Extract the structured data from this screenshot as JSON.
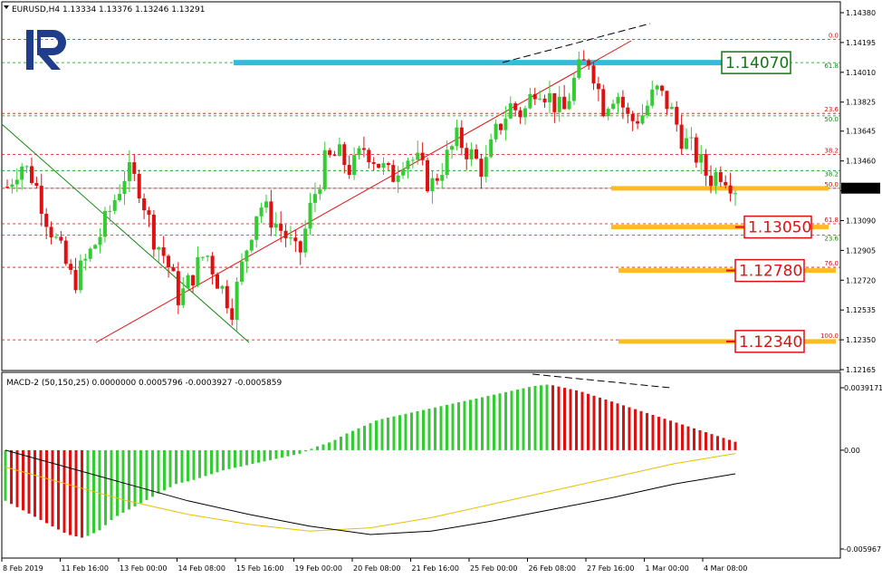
{
  "header": {
    "title": "EURUSD,H4 1.13334 1.13376 1.13246 1.13291",
    "macd_title": "MACD-2 (50,150,25) 0.0000000 0.0005796 -0.0003927 -0.0005859"
  },
  "logo": {
    "alt": "R"
  },
  "colors": {
    "bull": "#33cc33",
    "bear": "#dd1111",
    "trend": "#dd1111",
    "downtrend": "#118811",
    "fib_red": "#cc1111",
    "fib_green": "#118811",
    "cyan_zone": "#33bbdd",
    "orange_zone": "#ffbb22",
    "box_green": "#117711",
    "box_red": "#dd1111",
    "macd_signal": "#e8c000",
    "macd_line": "#000000"
  },
  "price_axis": {
    "labels": [
      "1.14380",
      "1.14195",
      "1.14010",
      "1.13825",
      "1.13645",
      "1.13460",
      "1.13275",
      "1.13090",
      "1.12905",
      "1.12720",
      "1.12535",
      "1.12350",
      "1.12165"
    ],
    "current": "1.13291"
  },
  "macd_axis": {
    "labels": [
      "0.0039171",
      "0.00",
      "-0.0059671"
    ]
  },
  "time_axis": {
    "labels": [
      "8 Feb 2019",
      "11 Feb 16:00",
      "13 Feb 00:00",
      "14 Feb 08:00",
      "15 Feb 16:00",
      "19 Feb 00:00",
      "20 Feb 08:00",
      "21 Feb 16:00",
      "25 Feb 00:00",
      "26 Feb 08:00",
      "27 Feb 16:00",
      "1 Mar 00:00",
      "4 Mar 08:00"
    ]
  },
  "levels": {
    "fib_a": [
      {
        "label": "0.0",
        "price": 1.14215
      },
      {
        "label": "23.6",
        "price": 1.13755
      },
      {
        "label": "38.2",
        "price": 1.135
      },
      {
        "label": "50.0",
        "price": 1.1329
      },
      {
        "label": "61.8",
        "price": 1.1307
      },
      {
        "label": "76.0",
        "price": 1.128
      },
      {
        "label": "100.0",
        "price": 1.1235
      }
    ],
    "fib_b": [
      {
        "label": "61.8",
        "price": 1.1407
      },
      {
        "label": "50.0",
        "price": 1.1374
      },
      {
        "label": "38.2",
        "price": 1.134
      },
      {
        "label": "23.6",
        "price": 1.13
      }
    ]
  },
  "boxes": [
    {
      "text": "1.14070",
      "price": 1.1407,
      "kind": "green"
    },
    {
      "text": "1.13050",
      "price": 1.1305,
      "kind": "red"
    },
    {
      "text": "1.12780",
      "price": 1.1278,
      "kind": "red"
    },
    {
      "text": "1.12340",
      "price": 1.1234,
      "kind": "red"
    }
  ],
  "chart_data": {
    "type": "candlestick",
    "symbol": "EURUSD",
    "timeframe": "H4",
    "ohlc_last": {
      "open": 1.13334,
      "high": 1.13376,
      "low": 1.13246,
      "close": 1.13291
    },
    "x": [
      "8 Feb 2019",
      "11 Feb 16:00",
      "13 Feb 00:00",
      "14 Feb 08:00",
      "15 Feb 16:00",
      "19 Feb 00:00",
      "20 Feb 08:00",
      "21 Feb 16:00",
      "25 Feb 00:00",
      "26 Feb 08:00",
      "27 Feb 16:00",
      "1 Mar 00:00",
      "4 Mar 08:00"
    ],
    "ylim": [
      1.12165,
      1.1438
    ],
    "close_path": [
      1.133,
      1.1345,
      1.1335,
      1.131,
      1.129,
      1.127,
      1.1285,
      1.13,
      1.132,
      1.134,
      1.133,
      1.13,
      1.1285,
      1.126,
      1.1275,
      1.129,
      1.127,
      1.1255,
      1.129,
      1.132,
      1.131,
      1.13,
      1.1285,
      1.132,
      1.1345,
      1.135,
      1.134,
      1.1355,
      1.1345,
      1.1335,
      1.135,
      1.1345,
      1.133,
      1.1345,
      1.136,
      1.135,
      1.134,
      1.1365,
      1.138,
      1.1375,
      1.1395,
      1.1385,
      1.1375,
      1.14,
      1.141,
      1.138,
      1.139,
      1.137,
      1.1375,
      1.139,
      1.138,
      1.136,
      1.135,
      1.1335,
      1.134,
      1.133
    ],
    "macd_series": [
      {
        "name": "histogram",
        "values": [
          -0.003,
          -0.0035,
          -0.004,
          -0.0045,
          -0.005,
          -0.0052,
          -0.0048,
          -0.004,
          -0.0035,
          -0.003,
          -0.0025,
          -0.002,
          -0.0018,
          -0.0015,
          -0.0012,
          -0.001,
          -0.0008,
          -0.0006,
          -0.0004,
          -0.0002,
          0.0002,
          0.0005,
          0.001,
          0.0014,
          0.0018,
          0.002,
          0.0022,
          0.0024,
          0.0026,
          0.0028,
          0.003,
          0.0032,
          0.0034,
          0.0036,
          0.0038,
          0.0039,
          0.0037,
          0.0035,
          0.0032,
          0.0029,
          0.0026,
          0.0023,
          0.002,
          0.0017,
          0.0014,
          0.0011,
          0.0008,
          0.0005
        ]
      },
      {
        "name": "signal",
        "values": [
          -0.001,
          -0.002,
          -0.003,
          -0.0038,
          -0.0044,
          -0.0048,
          -0.0046,
          -0.004,
          -0.0032,
          -0.0024,
          -0.0016,
          -0.0008,
          -0.0002
        ]
      },
      {
        "name": "main",
        "values": [
          0.0,
          -0.001,
          -0.002,
          -0.003,
          -0.0038,
          -0.0045,
          -0.005,
          -0.0048,
          -0.0042,
          -0.0035,
          -0.0028,
          -0.002,
          -0.0014
        ]
      }
    ]
  }
}
